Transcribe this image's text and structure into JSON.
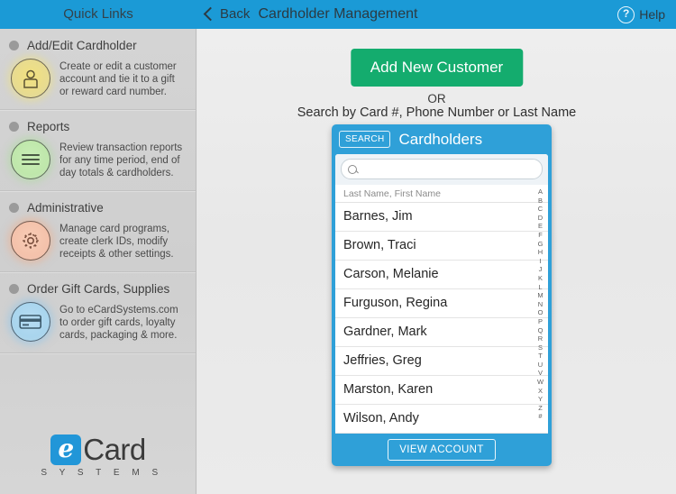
{
  "topbar": {
    "quick_links": "Quick Links",
    "back": "Back",
    "title": "Cardholder Management",
    "help": "Help",
    "help_icon": "question-circle-icon",
    "back_icon": "chevron-left-icon",
    "bg_color": "#1b9ad6"
  },
  "sidebar": {
    "items": [
      {
        "title": "Add/Edit Cardholder",
        "description": "Create or edit a customer account and tie it to a gift or reward card number.",
        "icon": "person-icon",
        "icon_color": "#e9dc8e"
      },
      {
        "title": "Reports",
        "description": "Review transaction reports for any time period, end of day totals & cardholders.",
        "icon": "lines-icon",
        "icon_color": "#bfe7ab"
      },
      {
        "title": "Administrative",
        "description": "Manage card programs, create clerk IDs, modify receipts & other settings.",
        "icon": "gear-icon",
        "icon_color": "#f4c2ab"
      },
      {
        "title": "Order Gift Cards, Supplies",
        "description": "Go to eCardSystems.com to order gift cards, loyalty cards, packaging & more.",
        "icon": "credit-card-icon",
        "icon_color": "#a9d5ee"
      }
    ],
    "logo": {
      "mark": "e",
      "name": "Card",
      "tagline": "S Y S T E M S",
      "mark_color": "#2196d8"
    }
  },
  "main": {
    "add_button": "Add New Customer",
    "add_button_color": "#14ac6e",
    "or_label": "OR",
    "search_hint": "Search by Card #, Phone Number or Last Name"
  },
  "panel": {
    "search_button": "SEARCH",
    "title": "Cardholders",
    "accent_color": "#2fa0d8",
    "search": {
      "icon": "search-icon",
      "value": "",
      "placeholder": ""
    },
    "list_header": "Last Name, First Name",
    "rows": [
      "Barnes, Jim",
      "Brown, Traci",
      "Carson, Melanie",
      "Furguson, Regina",
      "Gardner, Mark",
      "Jeffries, Greg",
      "Marston, Karen",
      "Wilson, Andy"
    ],
    "alpha_index": [
      "A",
      "B",
      "C",
      "D",
      "E",
      "F",
      "G",
      "H",
      "I",
      "J",
      "K",
      "L",
      "M",
      "N",
      "O",
      "P",
      "Q",
      "R",
      "S",
      "T",
      "U",
      "V",
      "W",
      "X",
      "Y",
      "Z",
      "#"
    ],
    "view_button": "VIEW ACCOUNT"
  }
}
